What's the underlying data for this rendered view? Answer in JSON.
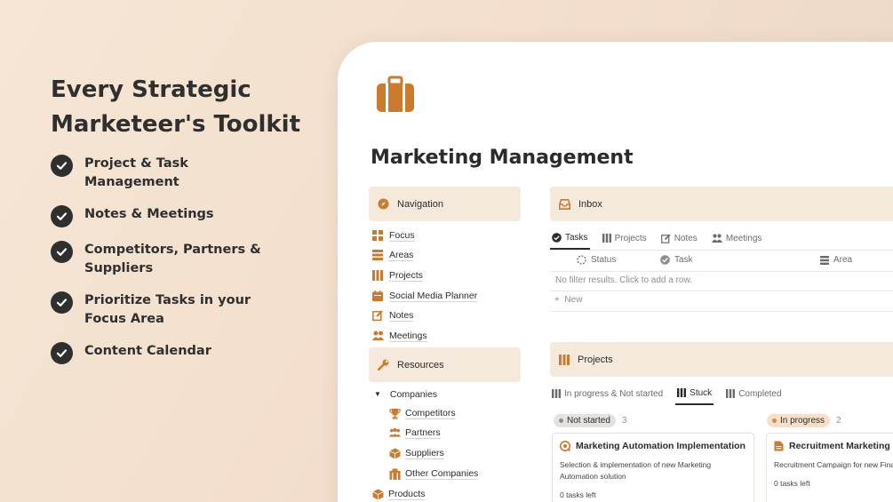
{
  "promo": {
    "title_line1": "Every Strategic",
    "title_line2": "Marketeer's Toolkit",
    "features": [
      "Project & Task Management",
      "Notes & Meetings",
      "Competitors, Partners & Suppliers",
      "Prioritize Tasks in your Focus Area",
      "Content Calendar"
    ]
  },
  "page": {
    "icon": "briefcase-icon",
    "title": "Marketing Management"
  },
  "navigation": {
    "heading": "Navigation",
    "items": [
      "Focus",
      "Areas",
      "Projects",
      "Social Media Planner",
      "Notes",
      "Meetings"
    ]
  },
  "resources": {
    "heading": "Resources",
    "group": "Companies",
    "children": [
      "Competitors",
      "Partners",
      "Suppliers",
      "Other Companies"
    ],
    "products": "Products"
  },
  "inbox": {
    "heading": "Inbox",
    "tabs": [
      "Tasks",
      "Projects",
      "Notes",
      "Meetings"
    ],
    "columns": [
      "Status",
      "Task",
      "Area"
    ],
    "empty_text": "No filter results. Click to add a row.",
    "new_label": "New"
  },
  "projects": {
    "heading": "Projects",
    "tabs": [
      "In progress & Not started",
      "Stuck",
      "Completed"
    ],
    "groups": [
      {
        "label": "Not started",
        "count": "3",
        "card": {
          "title": "Marketing Automation Implementation",
          "description": "Selection & implementation of new Marketing Automation solution",
          "tasks": "0 tasks left"
        }
      },
      {
        "label": "In progress",
        "count": "2",
        "card": {
          "title": "Recruitment Marketing Ca",
          "description": "Recruitment Campaign for new Fina",
          "tasks": "0 tasks left"
        }
      }
    ]
  },
  "colors": {
    "accent": "#cc7a2e",
    "callout_bg": "#f5e9dc",
    "text": "#2b2b2b"
  }
}
